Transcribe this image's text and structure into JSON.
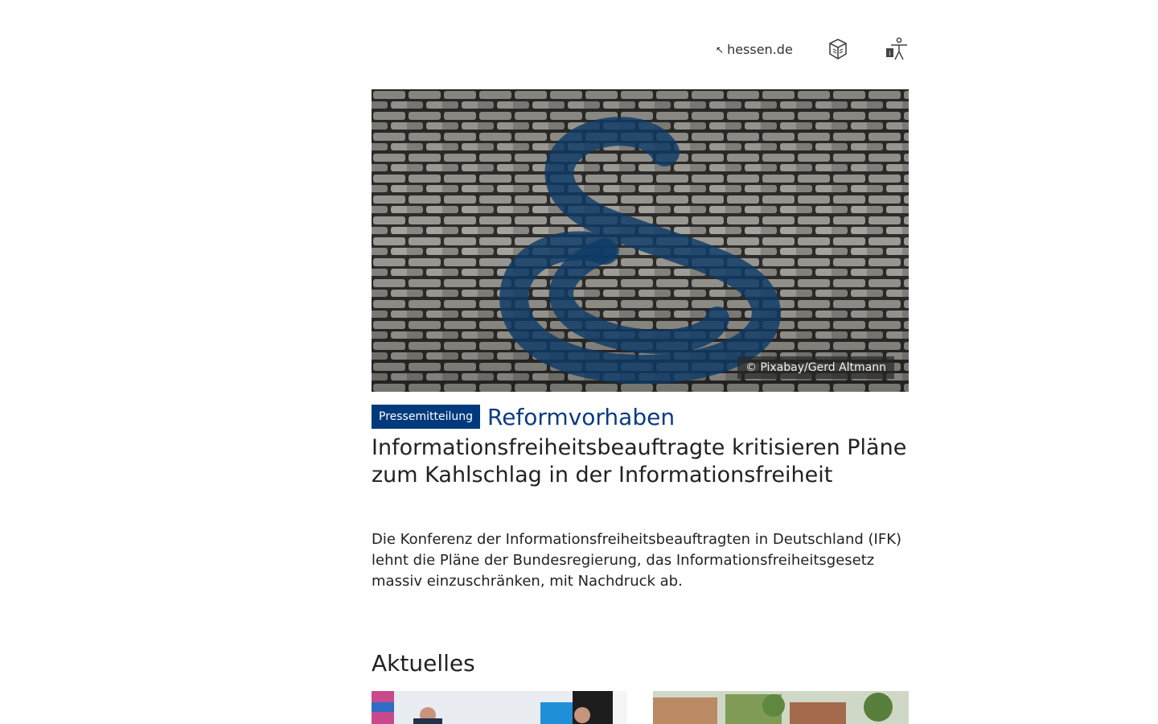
{
  "header": {
    "external_link": "hessen.de",
    "icons": [
      "external-link-arrow-icon",
      "easy-language-icon",
      "accessibility-icon"
    ]
  },
  "hero": {
    "image_alt": "Paragraph sign on cobblestone pavement",
    "credit": "© Pixabay/Gerd Altmann"
  },
  "article": {
    "badge": "Pressemitteilung",
    "kicker": "Reformvorhaben",
    "headline": "Informationsfreiheitsbeauftragte kritisieren Pläne zum Kahlschlag in der Informationsfreiheit",
    "teaser": "Die Konferenz der Informationsfreiheitsbeauftragten in Deutschland (IFK) lehnt die Pläne der Bundesregierung, das Informationsfreiheitsgesetz massiv einzuschränken, mit Nachdruck ab."
  },
  "news": {
    "title": "Aktuelles"
  },
  "colors": {
    "brand_blue": "#003a7d",
    "kicker_blue": "#0a3b84"
  }
}
